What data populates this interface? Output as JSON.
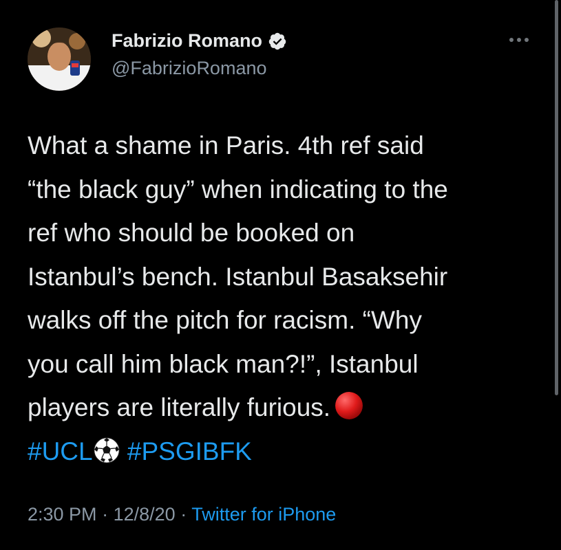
{
  "tweet": {
    "author_name": "Fabrizio Romano",
    "author_handle": "@FabrizioRomano",
    "verified_icon": "verified-badge-icon",
    "lines": [
      "What a shame in Paris. 4th ref said",
      "“the black guy” when indicating to the",
      "ref who should be booked on",
      "Istanbul’s bench. Istanbul Basaksehir",
      "walks off the pitch for racism. “Why",
      "you call him black man?!”, Istanbul",
      "players are literally furious."
    ],
    "emoji_red_circle": "red-circle-icon",
    "hashtag_1": "#UCL",
    "emoji_soccer_ball": "soccer-ball-icon",
    "hashtag_2": "#PSGIBFK",
    "time": "2:30 PM",
    "separator": "·",
    "date": "12/8/20",
    "source": "Twitter for iPhone"
  },
  "colors": {
    "background": "#000000",
    "text": "#e7e9ea",
    "secondary": "#8b98a5",
    "link": "#1d9bf0"
  }
}
